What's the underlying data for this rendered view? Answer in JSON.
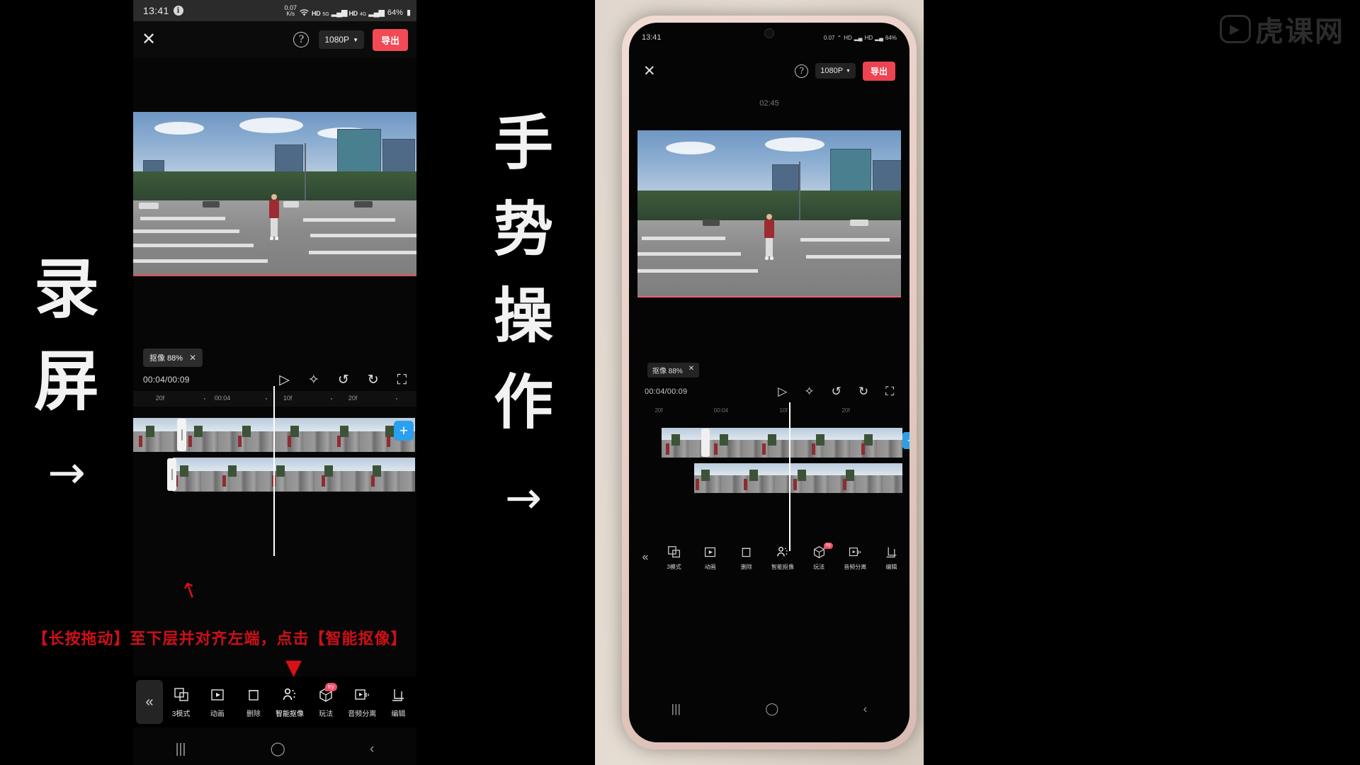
{
  "annotations": {
    "left_vertical": [
      "录",
      "屏"
    ],
    "left_arrow": "→",
    "middle_vertical": [
      "手",
      "势",
      "操",
      "作"
    ],
    "middle_arrow": "→",
    "red_instruction": "【长按拖动】至下层并对齐左端，点击【智能抠像】"
  },
  "watermark": {
    "text": "虎课网",
    "icon": "tiger-play-logo"
  },
  "status_bar": {
    "time": "13:41",
    "info_icon": "i",
    "net_speed_value": "0.07",
    "net_speed_unit": "K/s",
    "wifi_icon": "wifi-icon",
    "hd_label": "HD",
    "net_5g": "5G",
    "signal_icon": "signal-bars",
    "hd2_label": "HD",
    "net_4g": "4G",
    "signal2_icon": "signal-bars",
    "battery": "64%",
    "battery_icon": "battery-icon"
  },
  "app_header": {
    "close_icon": "close-icon",
    "help_icon": "help-icon",
    "help_glyph": "?",
    "resolution": "1080P",
    "caret": "▼",
    "export_label": "导出"
  },
  "preview": {
    "duration_label": "02:45"
  },
  "editor": {
    "keying_badge_label": "抠像 88%",
    "keying_close": "✕",
    "timecode": "00:04/00:09",
    "transport_icons": [
      {
        "name": "play-icon",
        "glyph": "▷"
      },
      {
        "name": "add-keyframe-icon",
        "glyph": "✧"
      },
      {
        "name": "undo-icon",
        "glyph": "↺"
      },
      {
        "name": "redo-icon",
        "glyph": "↻"
      },
      {
        "name": "fullscreen-icon",
        "glyph": "⛶"
      }
    ],
    "ruler_ticks": [
      "20f",
      "00:04",
      "10f",
      "20f"
    ],
    "add_clip_label": "+"
  },
  "toolbar": {
    "collapse_icon": "«",
    "items": [
      {
        "label": "3模式",
        "icon": "mode-icon",
        "badge": ""
      },
      {
        "label": "动画",
        "icon": "animation-icon",
        "badge": ""
      },
      {
        "label": "删除",
        "icon": "delete-icon",
        "badge": ""
      },
      {
        "label": "智能抠像",
        "icon": "smart-keying-icon",
        "badge": ""
      },
      {
        "label": "玩法",
        "icon": "playstyle-icon",
        "badge": "try"
      },
      {
        "label": "音频分离",
        "icon": "audio-separate-icon",
        "badge": ""
      },
      {
        "label": "编辑",
        "icon": "edit-icon",
        "badge": ""
      }
    ]
  },
  "nav_bar": {
    "recents": "|||",
    "home": "◯",
    "back": "‹"
  }
}
